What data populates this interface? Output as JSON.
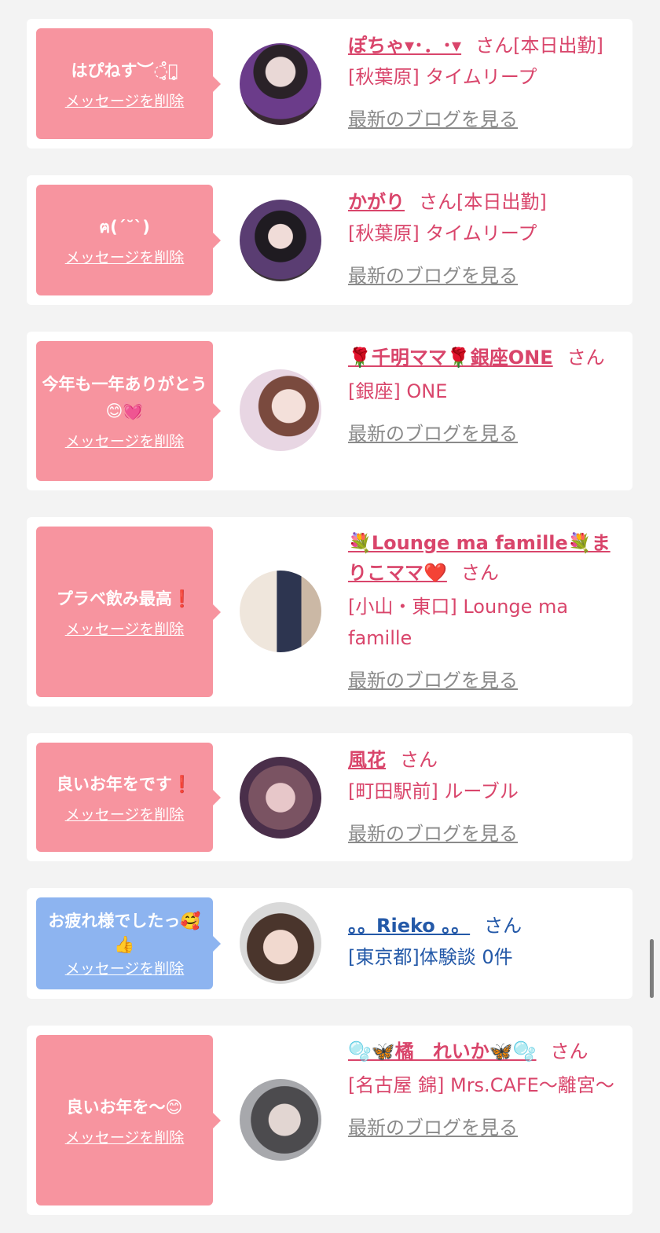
{
  "colors": {
    "pink_bubble": "#f7949f",
    "blue_bubble": "#8db4f0",
    "pink_text": "#d9456b",
    "blue_text": "#2459a8",
    "link_gray": "#8a8a8a",
    "page_bg": "#f3f3f3"
  },
  "delete_label": "メッセージを削除",
  "san_label": "さん",
  "blog_label": "最新のブログを見る",
  "cards": [
    {
      "message": "はぴねす︶◌̥̊⃝̥̥",
      "name": "ぽちゃ▾･．･▾",
      "status": "[本日出勤]",
      "shop": "[秋葉原] タイムリープ"
    },
    {
      "message": "ฅ(ˊ˘ˋ)",
      "name": "かがり",
      "status": "[本日出勤]",
      "shop": "[秋葉原] タイムリープ"
    },
    {
      "message": "今年も一年ありがとう😊💓",
      "name": "🌹千明ママ🌹銀座ONE",
      "status": "",
      "shop": "[銀座] ONE"
    },
    {
      "message": "プラベ飲み最高❗️",
      "name": "💐Lounge ma famille💐まりこママ❤️",
      "status": "",
      "shop": "[小山・東口] Lounge ma famille"
    },
    {
      "message": "良いお年をです❗️",
      "name": "風花",
      "status": "",
      "shop": "[町田駅前] ルーブル"
    },
    {
      "message": "お疲れ様でしたっ🥰👍",
      "name": "。。Rieko 。。",
      "status": "",
      "shop": "[東京都]体験談 0件"
    },
    {
      "message": "良いお年を〜😊",
      "name": "🫧🦋橘　れいか🦋🫧",
      "status": "",
      "shop": "[名古屋 錦] Mrs.CAFE〜離宮〜"
    }
  ]
}
